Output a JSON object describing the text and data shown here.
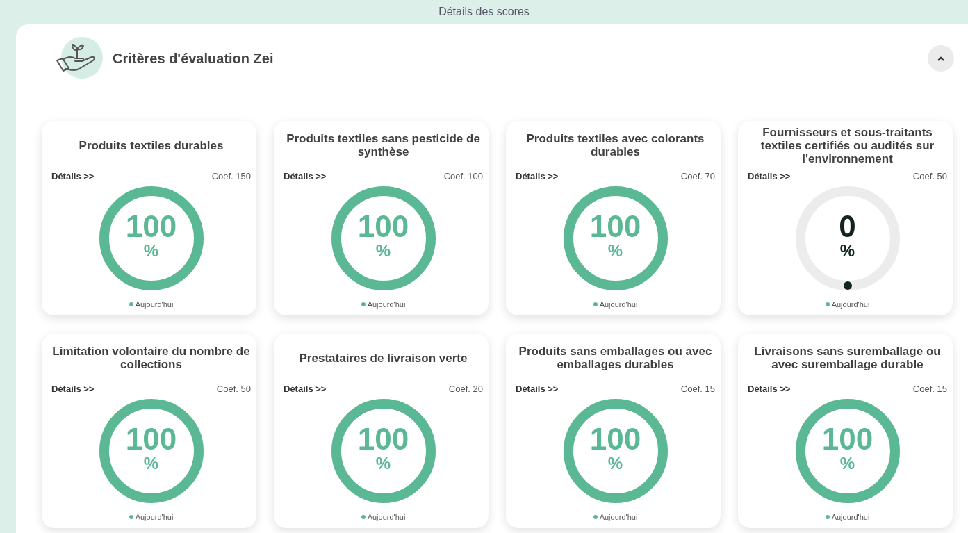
{
  "header": {
    "title": "Détails des scores"
  },
  "section": {
    "title": "Critères d'évaluation Zei",
    "expanded": true
  },
  "cards": [
    {
      "title": "Produits textiles durables",
      "details": "Détails >>",
      "coef": "Coef. 150",
      "value": "100",
      "unit": "%",
      "level": 1,
      "legend": "Aujourd'hui"
    },
    {
      "title": "Produits textiles sans pesticide de synthèse",
      "details": "Détails >>",
      "coef": "Coef. 100",
      "value": "100",
      "unit": "%",
      "level": 1,
      "legend": "Aujourd'hui"
    },
    {
      "title": "Produits textiles avec colorants durables",
      "details": "Détails >>",
      "coef": "Coef. 70",
      "value": "100",
      "unit": "%",
      "level": 1,
      "legend": "Aujourd'hui"
    },
    {
      "title": "Fournisseurs et sous-traitants textiles certifiés ou audités sur l'environnement",
      "details": "Détails >>",
      "coef": "Coef. 50",
      "value": "0",
      "unit": "%",
      "level": 0,
      "legend": "Aujourd'hui"
    },
    {
      "title": "Limitation volontaire du nombre de collections",
      "details": "Détails >>",
      "coef": "Coef. 50",
      "value": "100",
      "unit": "%",
      "level": 1,
      "legend": "Aujourd'hui"
    },
    {
      "title": "Prestataires de livraison verte",
      "details": "Détails >>",
      "coef": "Coef. 20",
      "value": "100",
      "unit": "%",
      "level": 1,
      "legend": "Aujourd'hui"
    },
    {
      "title": "Produits sans emballages ou avec emballages durables",
      "details": "Détails >>",
      "coef": "Coef. 15",
      "value": "100",
      "unit": "%",
      "level": 1,
      "legend": "Aujourd'hui"
    },
    {
      "title": "Livraisons sans suremballage ou avec suremballage durable",
      "details": "Détails >>",
      "coef": "Coef. 15",
      "value": "100",
      "unit": "%",
      "level": 1,
      "legend": "Aujourd'hui"
    }
  ]
}
